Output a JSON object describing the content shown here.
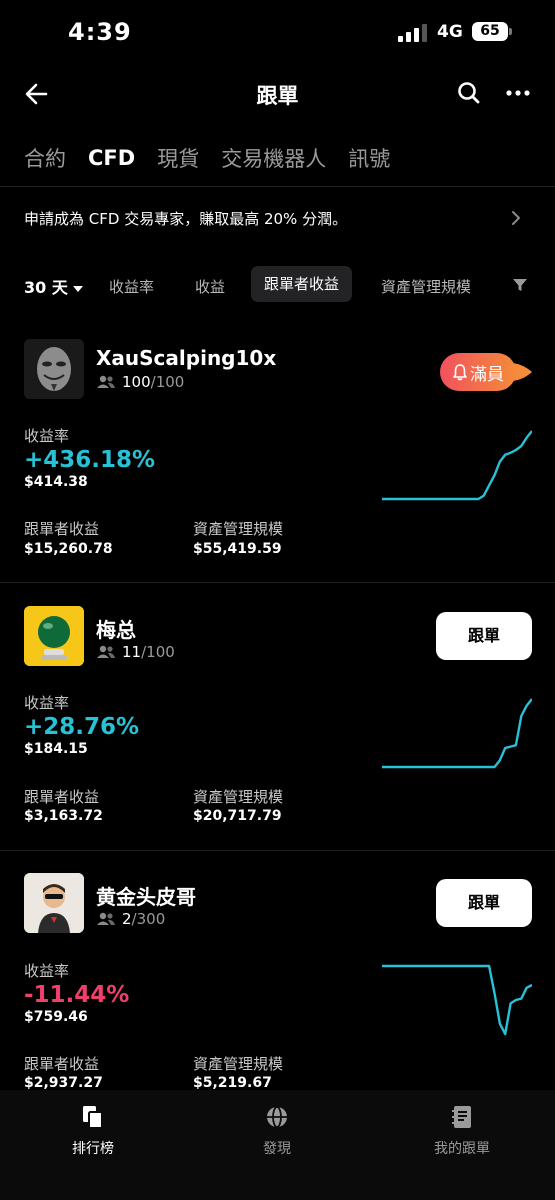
{
  "status_bar": {
    "time": "4:39",
    "network": "4G",
    "battery": "65"
  },
  "nav": {
    "title": "跟單"
  },
  "tabs": [
    {
      "label": "合約",
      "active": false
    },
    {
      "label": "CFD",
      "active": true
    },
    {
      "label": "現貨",
      "active": false
    },
    {
      "label": "交易機器人",
      "active": false
    },
    {
      "label": "訊號",
      "active": false
    }
  ],
  "banner": {
    "text": "申請成為 CFD 交易專家，賺取最高 20% 分潤。"
  },
  "filters": {
    "period": "30 天",
    "options": [
      "收益率",
      "收益",
      "跟單者收益",
      "資產管理規模"
    ],
    "active": "跟單者收益"
  },
  "traders": [
    {
      "name": "XauScalping10x",
      "followers_current": "100",
      "followers_max": "/100",
      "full_label": "滿員",
      "roi_label": "收益率",
      "roi": "+436.18%",
      "roi_sign": "pos",
      "pnl": "$414.38",
      "follower_pnl_label": "跟單者收益",
      "follower_pnl": "$15,260.78",
      "aum_label": "資產管理規模",
      "aum": "$55,419.59",
      "trend": [
        0,
        0,
        0,
        0,
        0,
        0,
        0,
        0,
        0,
        0,
        0,
        0,
        0,
        0,
        0,
        0,
        0,
        0,
        0,
        0.05,
        0.2,
        0.35,
        0.55,
        0.65,
        0.68,
        0.72,
        0.78,
        0.9,
        1.0
      ],
      "trend_color": "#28c2d6"
    },
    {
      "name": "梅总",
      "followers_current": "11",
      "followers_max": "/100",
      "copy_label": "跟單",
      "roi_label": "收益率",
      "roi": "+28.76%",
      "roi_sign": "pos",
      "pnl": "$184.15",
      "follower_pnl_label": "跟單者收益",
      "follower_pnl": "$3,163.72",
      "aum_label": "資產管理規模",
      "aum": "$20,717.79",
      "trend": [
        0,
        0,
        0,
        0,
        0,
        0,
        0,
        0,
        0,
        0,
        0,
        0,
        0,
        0,
        0,
        0,
        0,
        0,
        0,
        0,
        0,
        0,
        0.1,
        0.28,
        0.3,
        0.32,
        0.75,
        0.9,
        1.0
      ],
      "trend_color": "#28c2d6"
    },
    {
      "name": "黄金头皮哥",
      "followers_current": "2",
      "followers_max": "/300",
      "copy_label": "跟單",
      "roi_label": "收益率",
      "roi": "-11.44%",
      "roi_sign": "neg",
      "pnl": "$759.46",
      "follower_pnl_label": "跟單者收益",
      "follower_pnl": "$2,937.27",
      "aum_label": "資產管理規模",
      "aum": "$5,219.67",
      "trend": [
        1,
        1,
        1,
        1,
        1,
        1,
        1,
        1,
        1,
        1,
        1,
        1,
        1,
        1,
        1,
        1,
        1,
        1,
        1,
        1,
        1,
        0.6,
        0.15,
        0,
        0.45,
        0.5,
        0.52,
        0.68,
        0.72
      ],
      "trend_color": "#28c2d6"
    }
  ],
  "bottom_nav": [
    {
      "label": "排行榜",
      "icon": "leaderboard-icon",
      "active": true
    },
    {
      "label": "發現",
      "icon": "globe-icon",
      "active": false
    },
    {
      "label": "我的跟單",
      "icon": "notebook-icon",
      "active": false
    }
  ],
  "colors": {
    "positive": "#28c2d6",
    "negative": "#ef3f6c",
    "background": "#000000"
  }
}
